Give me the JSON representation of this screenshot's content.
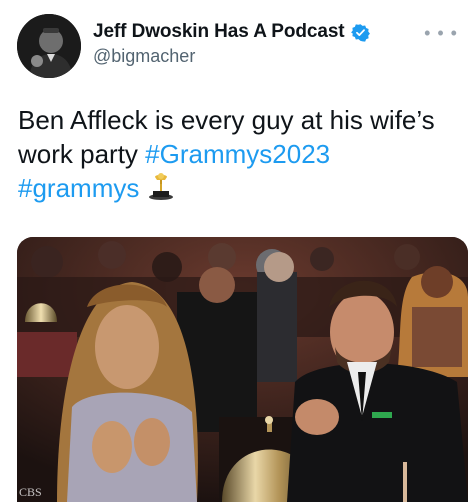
{
  "author": {
    "display_name": "Jeff Dwoskin Has A Podcast",
    "handle": "@bigmacher",
    "verified": true,
    "avatar_icon": "profile-photo"
  },
  "more_icon": "more-options-icon",
  "tweet": {
    "text_plain": "Ben Affleck is every guy at his wife’s work party ",
    "hashtag_1": "#Grammys2023",
    "hashtag_2": "#grammys",
    "trophy_icon": "grammy-trophy-icon"
  },
  "media": {
    "watermark": "CBS",
    "description_icon": "photo"
  },
  "colors": {
    "link": "#1d9bf0",
    "verified": "#1d9bf0",
    "secondary_text": "#536471"
  }
}
